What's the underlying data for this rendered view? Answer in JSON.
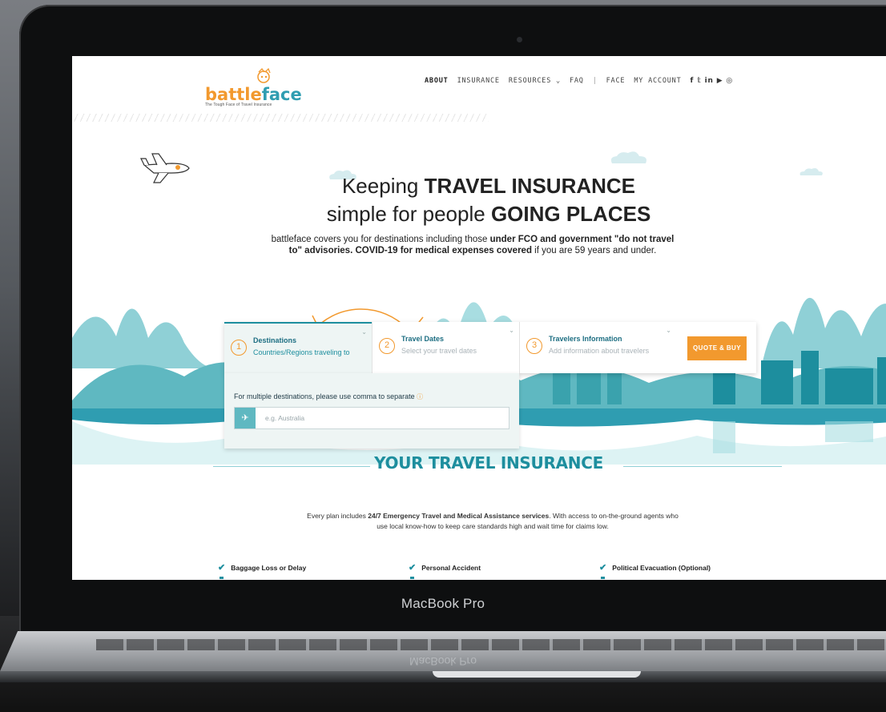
{
  "device": {
    "label": "MacBook Pro"
  },
  "site": {
    "logo": {
      "text_a": "battle",
      "text_b": "face",
      "tagline": "The Tough Face of Travel Insurance"
    },
    "nav": {
      "items": [
        "ABOUT",
        "INSURANCE",
        "RESOURCES ⌄",
        "FAQ",
        "|",
        "FACE",
        "MY ACCOUNT"
      ],
      "social_icons": [
        "facebook-icon",
        "twitter-icon",
        "linkedin-icon",
        "youtube-icon",
        "instagram-icon"
      ]
    },
    "hero": {
      "line1_prefix": "Keeping ",
      "line1_bold": "TRAVEL INSURANCE",
      "line2_prefix": "simple for people ",
      "line2_bold": "GOING PLACES",
      "sub_a": "battleface covers you for destinations including those ",
      "sub_b": "under FCO and government \"do not travel to\" advisories. COVID-19 for medical expenses covered",
      "sub_c": " if you are 59 years and under."
    },
    "quote_bar": {
      "steps": [
        {
          "num": "1",
          "title": "Destinations",
          "subtitle": "Countries/Regions traveling to"
        },
        {
          "num": "2",
          "title": "Travel Dates",
          "subtitle": "Select your travel dates"
        },
        {
          "num": "3",
          "title": "Travelers Information",
          "subtitle": "Add information about travelers"
        }
      ],
      "button": "QUOTE & BUY"
    },
    "destination_panel": {
      "label": "For multiple destinations, please use comma to separate",
      "placeholder": "e.g. Australia"
    },
    "section": {
      "title": "YOUR TRAVEL INSURANCE",
      "desc_a": "Every plan includes ",
      "desc_b": "24/7 Emergency Travel and Medical Assistance services",
      "desc_c": ". With access to on-the-ground agents who use local know-how to keep care standards high and wait time for claims low.",
      "features": [
        "Baggage Loss or Delay",
        "Personal Accident",
        "Political Evacuation (Optional)"
      ]
    },
    "colors": {
      "teal": "#1d8e9e",
      "orange": "#f2992e"
    }
  }
}
